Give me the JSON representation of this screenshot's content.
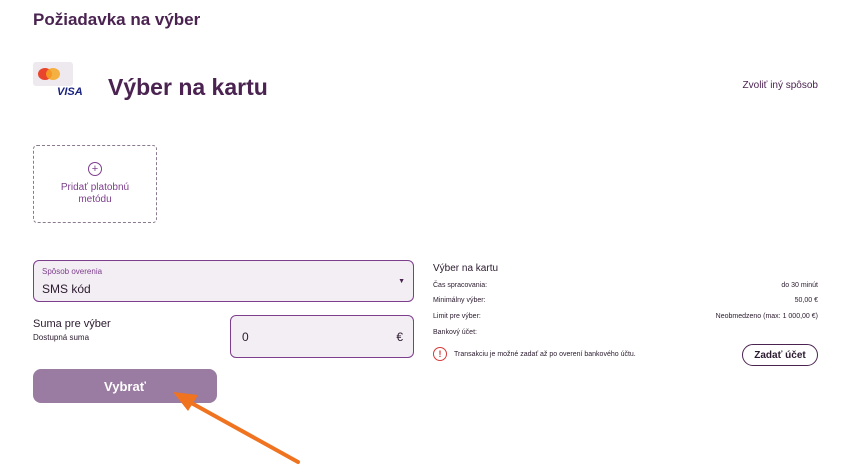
{
  "page": {
    "title": "Požiadavka na výber"
  },
  "method": {
    "title": "Výber na kartu",
    "change_link": "Zvoliť iný spôsob",
    "logo_text": "VISA"
  },
  "add_method": {
    "label": "Pridať platobnú metódu"
  },
  "verification": {
    "label": "Spôsob overenia",
    "value": "SMS kód"
  },
  "amount": {
    "label": "Suma pre výber",
    "available_label": "Dostupná suma",
    "value": "0",
    "currency": "€"
  },
  "submit": {
    "label": "Vybrať"
  },
  "info": {
    "title": "Výber na kartu",
    "rows": [
      {
        "label": "Čas spracovania:",
        "value": "do 30 minút"
      },
      {
        "label": "Minimálny výber:",
        "value": "50,00 €"
      },
      {
        "label": "Limit pre výber:",
        "value": "Neobmedzeno (max: 1 000,00 €)"
      },
      {
        "label": "Bankový účet:",
        "value": ""
      }
    ],
    "warning": "Transakciu je možné zadať až po overení bankového účtu.",
    "enter_account_label": "Zadať účet"
  },
  "colors": {
    "accent": "#7d3f8c",
    "button": "#9a7ba1",
    "title": "#4a2350",
    "warning": "#d33a3a",
    "arrow": "#f07320"
  }
}
